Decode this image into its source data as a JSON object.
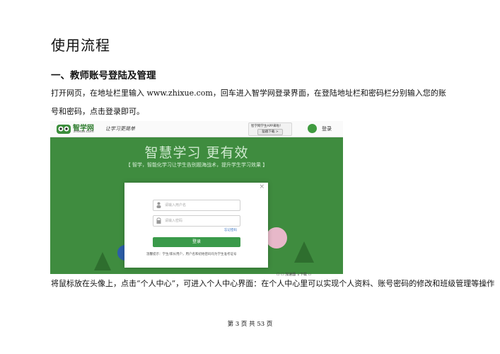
{
  "page_title": "使用流程",
  "section_heading": "一、教师账号登陆及管理",
  "paragraph1_line1": "打开网页，在地址栏里输入 www.zhixue.com，回车进入智学网登录界面，在登陆地址栏和密码栏分别输入您的账",
  "paragraph1_line2": "号和密码，点击登录即可。",
  "paragraph2": "将鼠标放在头像上，点击“个人中心”，可进入个人中心界面：在个人中心里可以实现个人资料、账号密码的修改和班级管理等操作",
  "footer": "第 3 页 共 53 页",
  "screenshot": {
    "logo_text": "智学网",
    "logo_domain": "zhixue.com",
    "slogan": "让学习更简单",
    "app_promo": "智学网学生APP来啦！",
    "app_download": "猛戳下载 >",
    "login_link": "登录",
    "banner_title": "智慧学习 更有效",
    "banner_subtitle": "【 智学，智能化学习让学生告别题海战术，提升学生学习效果 】",
    "username_placeholder": "请输入用户名",
    "password_placeholder": "请输入密码",
    "forgot_password": "忘记密码",
    "login_button": "登录",
    "tip": "温馨提示：学生/家长用户，用户名和初始密码均为学生准考证号",
    "bottom_toolbar": "☐ ☐ 加速器 ↓下载 ▭"
  },
  "colors": {
    "banner_green": "#3f8c3f",
    "login_button": "#3a9a4a",
    "link_blue": "#3b74c4"
  }
}
